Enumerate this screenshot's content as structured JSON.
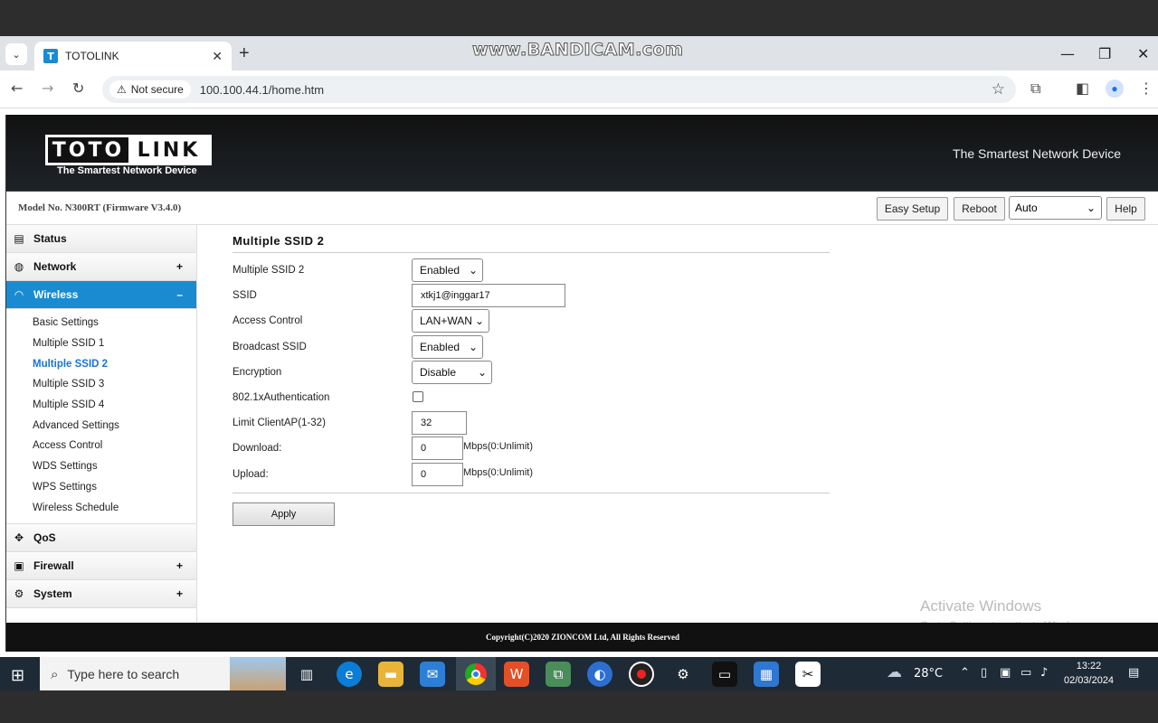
{
  "browser": {
    "tab_title": "TOTOLINK",
    "favicon_letter": "T",
    "security_label": "Not secure",
    "url": "100.100.44.1/home.htm",
    "recording_watermark": "www.BANDICAM.com"
  },
  "header": {
    "logo_left": "TOTO",
    "logo_right": "LINK",
    "logo_tagline": "The Smartest Network Device",
    "header_tagline": "The Smartest Network Device"
  },
  "modelbar": {
    "model": "Model No. N300RT (Firmware V3.4.0)",
    "easy_setup": "Easy Setup",
    "reboot": "Reboot",
    "language": "Auto",
    "help": "Help"
  },
  "sidebar": {
    "sections": [
      {
        "label": "Status",
        "icon": "chat-icon",
        "expander": ""
      },
      {
        "label": "Network",
        "icon": "globe-icon",
        "expander": "+"
      },
      {
        "label": "Wireless",
        "icon": "wifi-icon",
        "expander": "–"
      },
      {
        "label": "QoS",
        "icon": "qos-icon",
        "expander": ""
      },
      {
        "label": "Firewall",
        "icon": "lock-icon",
        "expander": "+"
      },
      {
        "label": "System",
        "icon": "gear-icon",
        "expander": "+"
      }
    ],
    "wireless_items": [
      "Basic Settings",
      "Multiple SSID 1",
      "Multiple SSID 2",
      "Multiple SSID 3",
      "Multiple SSID 4",
      "Advanced Settings",
      "Access Control",
      "WDS Settings",
      "WPS Settings",
      "Wireless Schedule"
    ],
    "active_item": "Multiple SSID 2"
  },
  "form": {
    "title": "Multiple SSID 2",
    "multiple_ssid_label": "Multiple SSID 2",
    "multiple_ssid_value": "Enabled",
    "ssid_label": "SSID",
    "ssid_value": "xtkj1@inggar17",
    "access_control_label": "Access Control",
    "access_control_value": "LAN+WAN",
    "broadcast_label": "Broadcast SSID",
    "broadcast_value": "Enabled",
    "encryption_label": "Encryption",
    "encryption_value": "Disable",
    "auth_label": "802.1xAuthentication",
    "auth_checked": false,
    "limit_label": "Limit ClientAP(1-32)",
    "limit_value": "32",
    "download_label": "Download:",
    "download_value": "0",
    "download_unit": "Mbps(0:Unlimit)",
    "upload_label": "Upload:",
    "upload_value": "0",
    "upload_unit": "Mbps(0:Unlimit)",
    "apply": "Apply"
  },
  "watermark": {
    "line1": "Activate Windows",
    "line2": "Go to Settings to activate Windows."
  },
  "footer": "Copyright(C)2020 ZIONCOM Ltd, All Rights Reserved",
  "taskbar": {
    "search_placeholder": "Type here to search",
    "weather": "28°C",
    "time": "13:22",
    "date": "02/03/2024"
  },
  "colors": {
    "accent": "#1a8bd0",
    "active_link": "#1a73d8",
    "header_bg": "#111111"
  }
}
